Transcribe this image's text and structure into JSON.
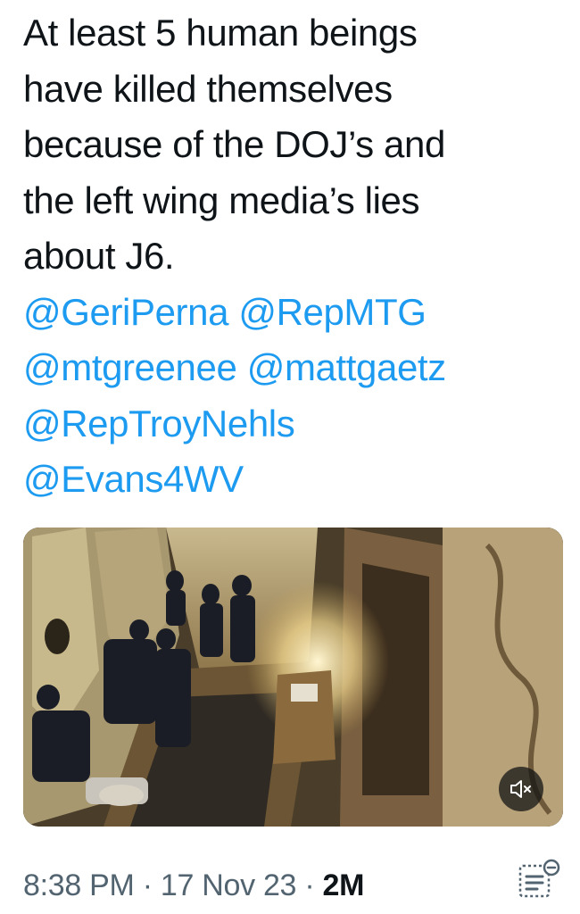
{
  "tweet": {
    "text_lines": [
      "At least 5 human beings",
      "have killed themselves",
      "because of the DOJ’s and",
      "the left wing media’s lies",
      "about J6."
    ],
    "mentions": [
      [
        "@GeriPerna",
        "@RepMTG"
      ],
      [
        "@mtgreenee",
        "@mattgaetz"
      ],
      [
        "@RepTroyNehls"
      ],
      [
        "@Evans4WV"
      ]
    ],
    "link_color": "#1d9bf0"
  },
  "media": {
    "type": "video",
    "mute_icon": "speaker-muted-icon"
  },
  "meta": {
    "time": "8:38 PM",
    "separator": "·",
    "date": "17 Nov 23",
    "views": "2M",
    "analytics_icon": "analytics-icon"
  }
}
